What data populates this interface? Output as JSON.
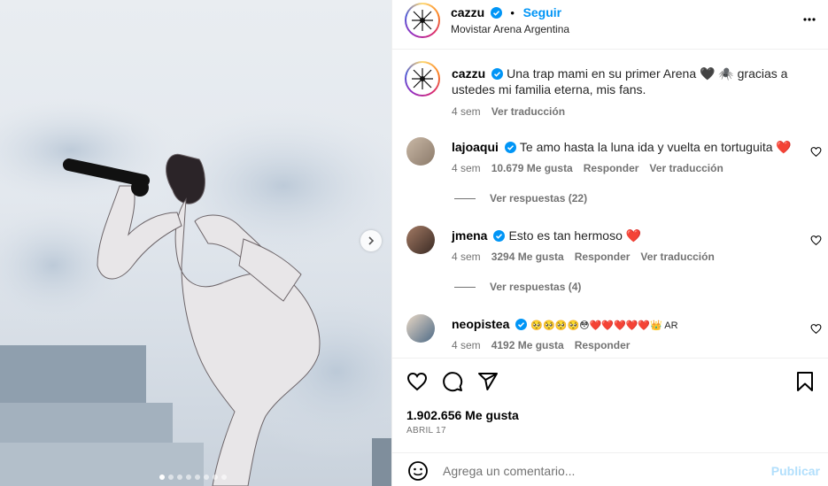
{
  "post": {
    "username": "cazzu",
    "follow_label": "Seguir",
    "separator": "•",
    "location": "Movistar Arena Argentina",
    "more_label": "•••"
  },
  "caption": {
    "username": "cazzu",
    "text": "Una trap mami en su primer Arena 🖤 🕷️ gracias a ustedes mi familia eterna, mis fans.",
    "time": "4 sem",
    "translate": "Ver traducción"
  },
  "comments": [
    {
      "username": "lajoaqui",
      "text": "Te amo hasta la luna ida y vuelta en tortuguita ❤️",
      "time": "4 sem",
      "likes": "10.679 Me gusta",
      "reply": "Responder",
      "translate": "Ver traducción",
      "view_replies": "Ver respuestas (22)"
    },
    {
      "username": "jmena",
      "text": "Esto es tan hermoso ❤️",
      "time": "4 sem",
      "likes": "3294 Me gusta",
      "reply": "Responder",
      "translate": "Ver traducción",
      "view_replies": "Ver respuestas (4)"
    },
    {
      "username": "neopistea",
      "text": "🥺🥺🥺🥺😳❤️❤️❤️❤️❤️👑 AR",
      "time": "4 sem",
      "likes": "4192 Me gusta",
      "reply": "Responder"
    }
  ],
  "footer": {
    "likes": "1.902.656 Me gusta",
    "date": "ABRIL 17",
    "comment_placeholder": "Agrega un comentario...",
    "post_label": "Publicar"
  },
  "colors": {
    "link": "#0095f6",
    "verified": "#0095f6",
    "secondary_text": "#737373",
    "post_disabled": "#b2dffc"
  },
  "carousel": {
    "slides": 8,
    "active_index": 0
  }
}
